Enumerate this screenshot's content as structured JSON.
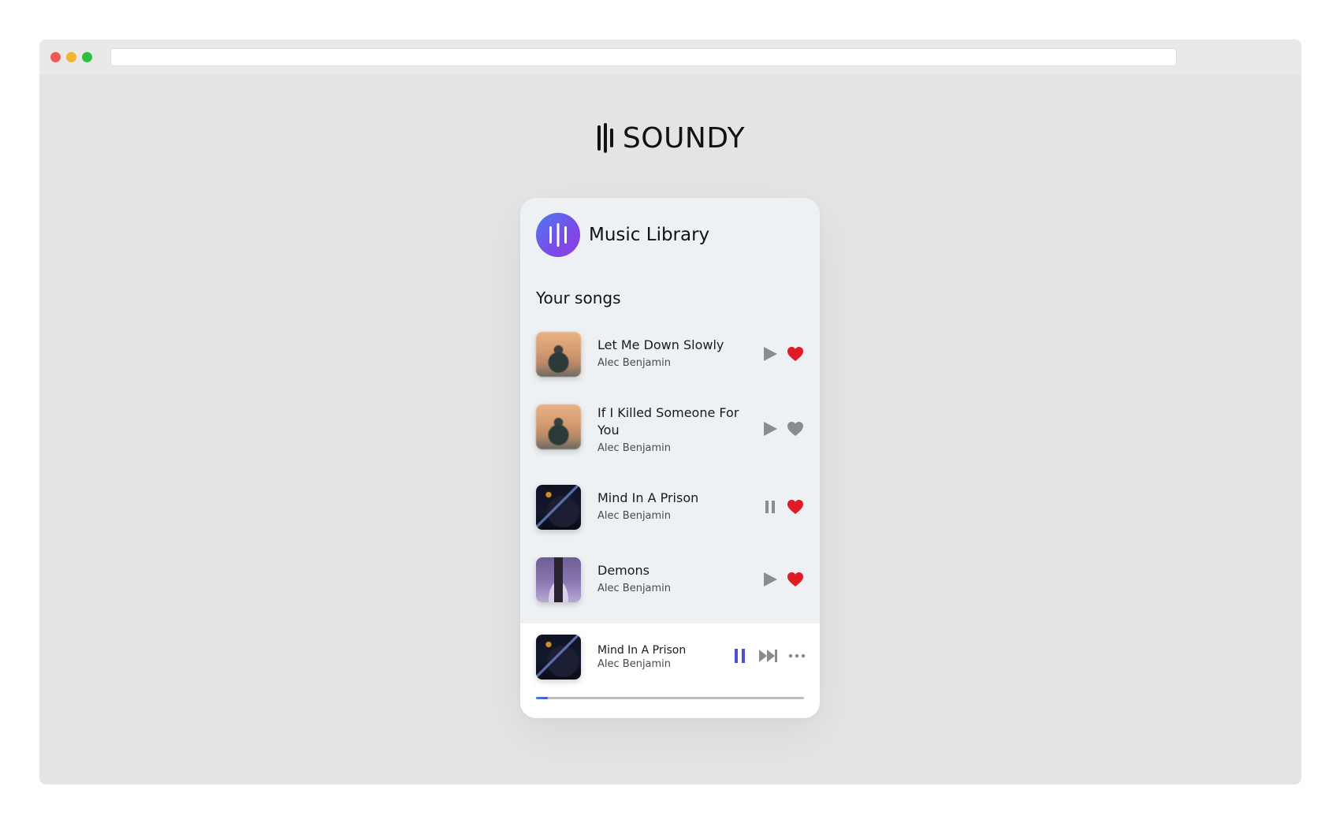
{
  "browser": {
    "traffic_lights": {
      "close_color": "#ee5a55",
      "minimize_color": "#f2b433",
      "maximize_color": "#2fc043"
    },
    "address_bar": ""
  },
  "brand": {
    "logo_icon": "sound-bars-icon",
    "name": "SOUNDY"
  },
  "library": {
    "badge_icon": "sound-bars-icon",
    "badge_gradient": [
      "#4a7cf0",
      "#8f3fe0"
    ],
    "title": "Music Library",
    "section_title": "Your songs",
    "songs": [
      {
        "title": "Let Me Down Slowly",
        "artist": "Alec Benjamin",
        "cover": "warm",
        "state": "play",
        "liked": true
      },
      {
        "title": "If I Killed Someone For You",
        "artist": "Alec Benjamin",
        "cover": "warm",
        "state": "play",
        "liked": false
      },
      {
        "title": "Mind In A Prison",
        "artist": "Alec Benjamin",
        "cover": "dark",
        "state": "pause",
        "liked": true
      },
      {
        "title": "Demons",
        "artist": "Alec Benjamin",
        "cover": "purple",
        "state": "play",
        "liked": true
      }
    ]
  },
  "player": {
    "title": "Mind In A Prison",
    "artist": "Alec Benjamin",
    "cover": "dark",
    "pause_icon": "pause-icon",
    "next_icon": "skip-next-icon",
    "more_icon": "more-horizontal-icon",
    "progress": 0.045
  },
  "colors": {
    "accent": "#4b4fd6",
    "liked": "#e01b24",
    "unliked": "#8c8c8c",
    "control": "#8c8c8c",
    "progress_track": "#bdbdbd"
  }
}
